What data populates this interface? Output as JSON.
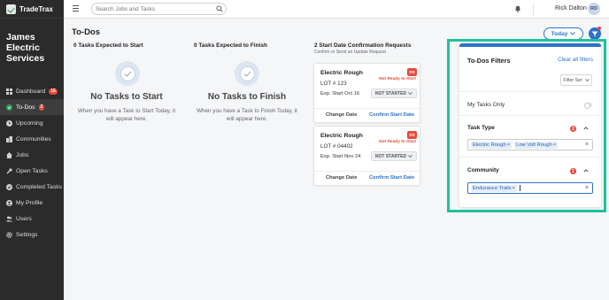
{
  "app": {
    "name": "TradeTrax",
    "company": "James Electric Services"
  },
  "sidebar": {
    "items": [
      {
        "label": "Dashboard",
        "icon": "dashboard-icon",
        "badge": "15",
        "active": false
      },
      {
        "label": "To-Dos",
        "icon": "check-circle-icon",
        "badge": "2",
        "active": true
      },
      {
        "label": "Upcoming",
        "icon": "calendar-icon",
        "badge": "",
        "active": false
      },
      {
        "label": "Communities",
        "icon": "communities-icon",
        "badge": "",
        "active": false
      },
      {
        "label": "Jobs",
        "icon": "home-icon",
        "badge": "",
        "active": false
      },
      {
        "label": "Open Tasks",
        "icon": "wrench-icon",
        "badge": "",
        "active": false
      },
      {
        "label": "Completed Tasks",
        "icon": "check-circle-icon",
        "badge": "",
        "active": false
      },
      {
        "label": "My Profile",
        "icon": "user-icon",
        "badge": "",
        "active": false
      },
      {
        "label": "Users",
        "icon": "users-icon",
        "badge": "",
        "active": false
      },
      {
        "label": "Settings",
        "icon": "gear-icon",
        "badge": "",
        "active": false
      }
    ]
  },
  "header": {
    "search_placeholder": "Search Jobs and Tasks",
    "user_name": "Rick Dalton",
    "user_initials": "RD"
  },
  "main": {
    "title": "To-Dos",
    "today_label": "Today",
    "columns": [
      {
        "title": "0 Tasks Expected to Start",
        "empty_title": "No Tasks to Start",
        "empty_text": "When you have a Task to Start Today, it will appear here."
      },
      {
        "title": "0 Tasks Expected to Finish",
        "empty_title": "No Tasks to Finish",
        "empty_text": "When you have a Task to Finish Today, it will appear here."
      }
    ],
    "requests": {
      "title": "2 Start Date Confirmation Requests",
      "subtitle": "Confirm or Send an Update Request",
      "cards": [
        {
          "name": "Electric Rough",
          "lot": "LOT # 123",
          "exp": "Exp. Start Oct 16",
          "initials": "DS",
          "status": "Not Ready to Start",
          "state": "NOT STARTED",
          "change": "Change Date",
          "confirm": "Confirm Start Date"
        },
        {
          "name": "Electric Rough",
          "lot": "LOT # 04402",
          "exp": "Exp. Start Nov 24",
          "initials": "DS",
          "status": "Not Ready to Start",
          "state": "NOT STARTED",
          "change": "Change Date",
          "confirm": "Confirm Start Date"
        }
      ]
    }
  },
  "filters": {
    "title": "To-Dos Filters",
    "clear_label": "Clear all filters",
    "filter_set_label": "Filter Set",
    "my_tasks_label": "My Tasks Only",
    "my_tasks_on": false,
    "task_type": {
      "label": "Task Type",
      "count": "2",
      "chips": [
        "Electric Rough",
        "Low Volt Rough"
      ]
    },
    "community": {
      "label": "Community",
      "count": "1",
      "chips": [
        "Endurance Trails"
      ]
    }
  },
  "colors": {
    "accent": "#2d72c8",
    "highlight": "#1fc29a",
    "alert": "#e64a3c",
    "sidebar": "#2b2b2b"
  }
}
